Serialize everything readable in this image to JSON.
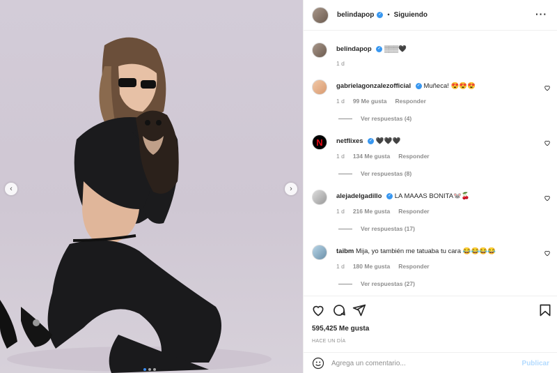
{
  "header": {
    "username": "belindapop",
    "separator": "•",
    "follow_label": "Siguiendo",
    "more_label": "···"
  },
  "caption": {
    "username": "belindapop",
    "text": "▒▒▒🖤",
    "time": "1 d"
  },
  "comments": [
    {
      "username": "gabrielagonzalezofficial",
      "verified": true,
      "text": "Muñeca! 😍😍😍",
      "time": "1 d",
      "likes": "99 Me gusta",
      "reply": "Responder",
      "replies": "Ver respuestas (4)"
    },
    {
      "username": "netflixes",
      "verified": true,
      "text": "🖤🖤🖤",
      "time": "1 d",
      "likes": "134 Me gusta",
      "reply": "Responder",
      "replies": "Ver respuestas (8)"
    },
    {
      "username": "alejadelgadillo",
      "verified": true,
      "text": "LA MAAAS BONITA🐭🍒",
      "time": "1 d",
      "likes": "216 Me gusta",
      "reply": "Responder",
      "replies": "Ver respuestas (17)"
    },
    {
      "username": "taibm",
      "verified": false,
      "text": "Mija, yo también me tatuaba tu cara 😂😂😂😂",
      "time": "1 d",
      "likes": "180 Me gusta",
      "reply": "Responder",
      "replies": "Ver respuestas (27)"
    }
  ],
  "footer": {
    "likes": "595,425 Me gusta",
    "ago": "HACE UN DÍA",
    "comment_placeholder": "Agrega un comentario...",
    "post_label": "Publicar"
  },
  "carousel": {
    "current": 1,
    "total": 3
  },
  "icons": [
    "heart-icon",
    "comment-icon",
    "share-icon",
    "bookmark-icon",
    "emoji-icon",
    "chevron-left-icon",
    "chevron-right-icon",
    "verified-icon"
  ],
  "colors": {
    "verified": "#3897f0",
    "post_disabled": "#b3dbff",
    "muted": "#8e8e8e",
    "carousel_active": "#3b8ef3"
  }
}
